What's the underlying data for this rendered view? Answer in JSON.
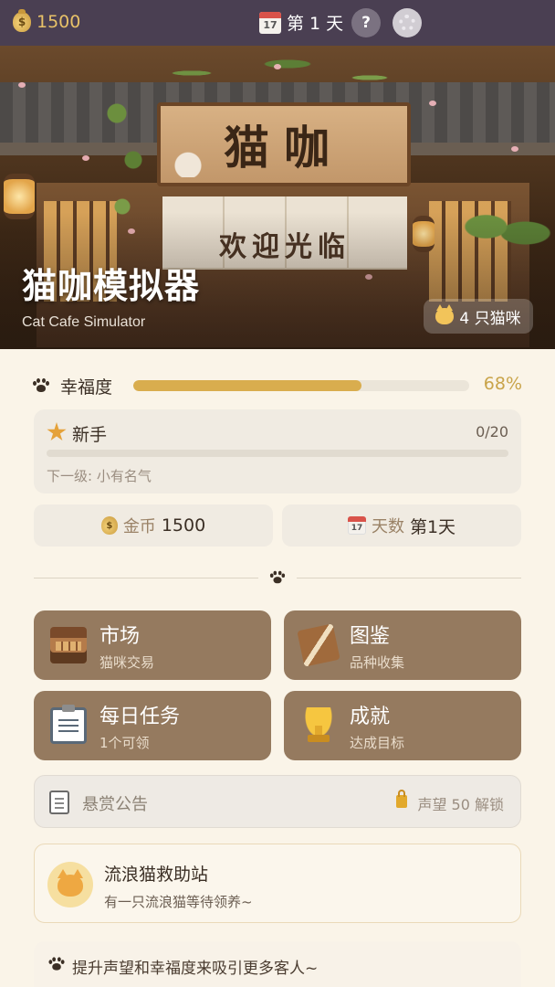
{
  "topbar": {
    "gold": "1500",
    "calendar_day_number": "17",
    "day_label": "第 1 天",
    "help_label": "?",
    "coin_icon": "money-bag-icon",
    "settings_icon": "gear-icon"
  },
  "hero": {
    "sign_text": "猫咖",
    "curtain_text": "欢迎光临",
    "title": "猫咖模拟器",
    "subtitle": "Cat Cafe Simulator",
    "cat_count": "4 只猫咪"
  },
  "happiness": {
    "label": "幸福度",
    "value_text": "68%",
    "fraction": 0.68,
    "bar_color": "#d9ad4e"
  },
  "level": {
    "name": "新手",
    "progress_text": "0/20",
    "progress_fraction": 0,
    "next_level": "下一级: 小有名气"
  },
  "stats": {
    "gold_label": "金币",
    "gold_value": "1500",
    "day_label": "天数",
    "day_value": "第1天"
  },
  "features": [
    {
      "title": "市场",
      "subtitle": "猫咪交易",
      "icon": "market-stall-icon"
    },
    {
      "title": "图鉴",
      "subtitle": "品种收集",
      "icon": "book-icon"
    },
    {
      "title": "每日任务",
      "subtitle": "1个可领",
      "icon": "clipboard-icon"
    },
    {
      "title": "成就",
      "subtitle": "达成目标",
      "icon": "trophy-icon"
    }
  ],
  "bounty": {
    "title": "悬赏公告",
    "unlock_text": "声望 50 解锁"
  },
  "rescue": {
    "title": "流浪猫救助站",
    "subtitle": "有一只流浪猫等待领养~"
  },
  "tip": {
    "text": "提升声望和幸福度来吸引更多客人~"
  },
  "colors": {
    "topbar_bg": "#4a3f52",
    "feature_card_bg": "#957a5f",
    "gold_text": "#e8c268",
    "page_bg": "#faf4e8"
  }
}
